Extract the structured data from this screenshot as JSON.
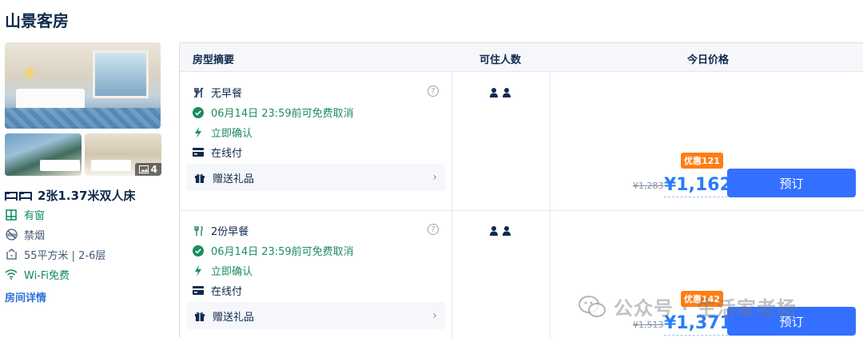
{
  "page": {
    "title": "山景客房"
  },
  "room": {
    "photo_count": "4",
    "bed": "2张1.37米双人床",
    "features": [
      {
        "icon": "window-icon",
        "text": "有窗",
        "highlight": true
      },
      {
        "icon": "no-smoking-icon",
        "text": "禁烟",
        "highlight": false
      },
      {
        "icon": "area-icon",
        "text": "55平方米 | 2-6层",
        "highlight": false
      },
      {
        "icon": "wifi-icon",
        "text": "Wi-Fi免费",
        "highlight": true
      }
    ],
    "detail_link": "房间详情"
  },
  "table": {
    "headers": {
      "summary": "房型摘要",
      "occupancy": "可住人数",
      "price": "今日价格"
    },
    "rows": [
      {
        "meal": "无早餐",
        "cancel": "06月14日 23:59前可免费取消",
        "confirm": "立即确认",
        "payment": "在线付",
        "gift": "赠送礼品",
        "badge": "优惠121",
        "old_price": "¥1,283",
        "price": "¥1,162",
        "book": "预订"
      },
      {
        "meal": "2份早餐",
        "cancel": "06月14日 23:59前可免费取消",
        "confirm": "立即确认",
        "payment": "在线付",
        "gift": "赠送礼品",
        "badge": "优惠142",
        "old_price": "¥1,513",
        "price": "¥1,371",
        "book": "预订"
      }
    ]
  },
  "watermark": "公众号 · 生活家老杨",
  "colors": {
    "primary": "#3370ff",
    "price": "#287dfa",
    "badge": "#ff7d13",
    "green": "#1c8c5e"
  }
}
